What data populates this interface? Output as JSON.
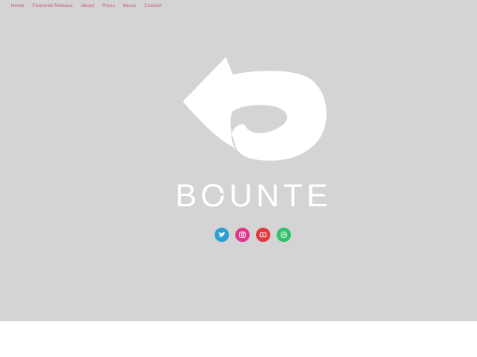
{
  "nav": {
    "items": [
      {
        "label": "Home"
      },
      {
        "label": "Featured Release"
      },
      {
        "label": "About"
      },
      {
        "label": "Press"
      },
      {
        "label": "Music"
      },
      {
        "label": "Contact"
      }
    ],
    "link_color": "#c4527a"
  },
  "brand": {
    "name": "BOUNTE",
    "logo_icon": "curled-arrow-logo",
    "logo_color": "#ffffff",
    "background_color": "#d4d4d4"
  },
  "social": [
    {
      "icon": "twitter-icon",
      "color": "#2a9fd6"
    },
    {
      "icon": "instagram-icon",
      "color": "#e0358a"
    },
    {
      "icon": "youtube-icon",
      "color": "#e0383e"
    },
    {
      "icon": "spotify-icon",
      "color": "#2fc26a"
    }
  ]
}
